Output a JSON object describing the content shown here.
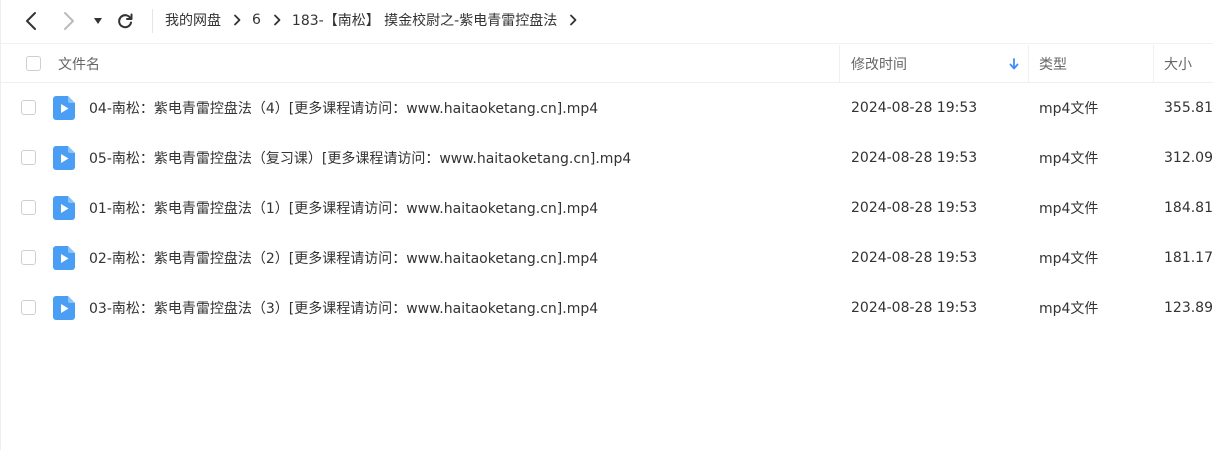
{
  "nav": {
    "back_icon": "chevron-left-icon",
    "forward_icon": "chevron-right-icon",
    "dropdown_icon": "caret-down-icon",
    "refresh_icon": "refresh-icon",
    "breadcrumb": [
      "我的网盘",
      "6",
      "183-【南松】 摸金校尉之-紫电青雷控盘法"
    ]
  },
  "columns": {
    "name": "文件名",
    "modified": "修改时间",
    "type": "类型",
    "size": "大小",
    "sort_icon": "arrow-down-icon"
  },
  "files": [
    {
      "name": "04-南松：紫电青雷控盘法（4）[更多课程请访问：www.haitaoketang.cn].mp4",
      "modified": "2024-08-28 19:53",
      "type": "mp4文件",
      "size": "355.81"
    },
    {
      "name": "05-南松：紫电青雷控盘法（复习课）[更多课程请访问：www.haitaoketang.cn].mp4",
      "modified": "2024-08-28 19:53",
      "type": "mp4文件",
      "size": "312.09"
    },
    {
      "name": "01-南松：紫电青雷控盘法（1）[更多课程请访问：www.haitaoketang.cn].mp4",
      "modified": "2024-08-28 19:53",
      "type": "mp4文件",
      "size": "184.81"
    },
    {
      "name": "02-南松：紫电青雷控盘法（2）[更多课程请访问：www.haitaoketang.cn].mp4",
      "modified": "2024-08-28 19:53",
      "type": "mp4文件",
      "size": "181.17"
    },
    {
      "name": "03-南松：紫电青雷控盘法（3）[更多课程请访问：www.haitaoketang.cn].mp4",
      "modified": "2024-08-28 19:53",
      "type": "mp4文件",
      "size": "123.89"
    }
  ],
  "colors": {
    "file_icon": "#4a9ff5",
    "sort_arrow": "#3e8ef7",
    "text": "#333333",
    "header_text": "#666666"
  }
}
